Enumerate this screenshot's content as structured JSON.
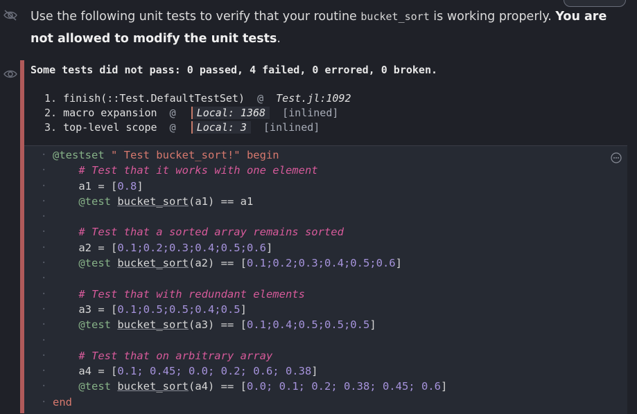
{
  "prose": {
    "text_before": "Use the following unit tests to verify that your routine ",
    "code": "bucket_sort",
    "text_after": " is working properly. ",
    "bold": "You are not allowed to modify the unit tests",
    "end": "."
  },
  "error": {
    "header": "Some tests did not pass: 0 passed, 4 failed, 0 errored, 0 broken.",
    "trace": [
      {
        "num": "1.",
        "fn": "finish(::Test.DefaultTestSet)",
        "at": "@",
        "file": "Test.jl:1092"
      },
      {
        "num": "2.",
        "fn": "macro expansion",
        "at": "@",
        "loc": "Local: 1368",
        "inlined": "[inlined]"
      },
      {
        "num": "3.",
        "fn": "top-level scope",
        "at": "@",
        "loc": "Local: 3",
        "inlined": "[inlined]"
      }
    ]
  },
  "code": {
    "l1": {
      "mac": "@testset",
      "str": " \" Test bucket_sort!\"",
      "kw": " begin"
    },
    "l2": "# Test that it works with one element",
    "l3": {
      "a": "a1 = [",
      "n": "0.8",
      "b": "]"
    },
    "l4": {
      "mac": "@test",
      "fn": "bucket_sort",
      "rest": "(a1) == a1"
    },
    "l6": "# Test that a sorted array remains sorted",
    "l7": {
      "a": "a2 = [",
      "n": "0.1;0.2;0.3;0.4;0.5;0.6",
      "b": "]"
    },
    "l8": {
      "mac": "@test",
      "fn": "bucket_sort",
      "rest": "(a2) == [",
      "n": "0.1;0.2;0.3;0.4;0.5;0.6",
      "b": "]"
    },
    "l10": "# Test that with redundant elements",
    "l11": {
      "a": "a3 = [",
      "n": "0.1;0.5;0.5;0.4;0.5",
      "b": "]"
    },
    "l12": {
      "mac": "@test",
      "fn": "bucket_sort",
      "rest": "(a3) == [",
      "n": "0.1;0.4;0.5;0.5;0.5",
      "b": "]"
    },
    "l14": "# Test that on arbitrary array",
    "l15": {
      "a": "a4 = [",
      "n": "0.1; 0.45; 0.0; 0.2; 0.6; 0.38",
      "b": "]"
    },
    "l16": {
      "mac": "@test",
      "fn": "bucket_sort",
      "rest": "(a4) == [",
      "n": "0.0; 0.1; 0.2; 0.38; 0.45; 0.6",
      "b": "]"
    },
    "l17": "end"
  }
}
